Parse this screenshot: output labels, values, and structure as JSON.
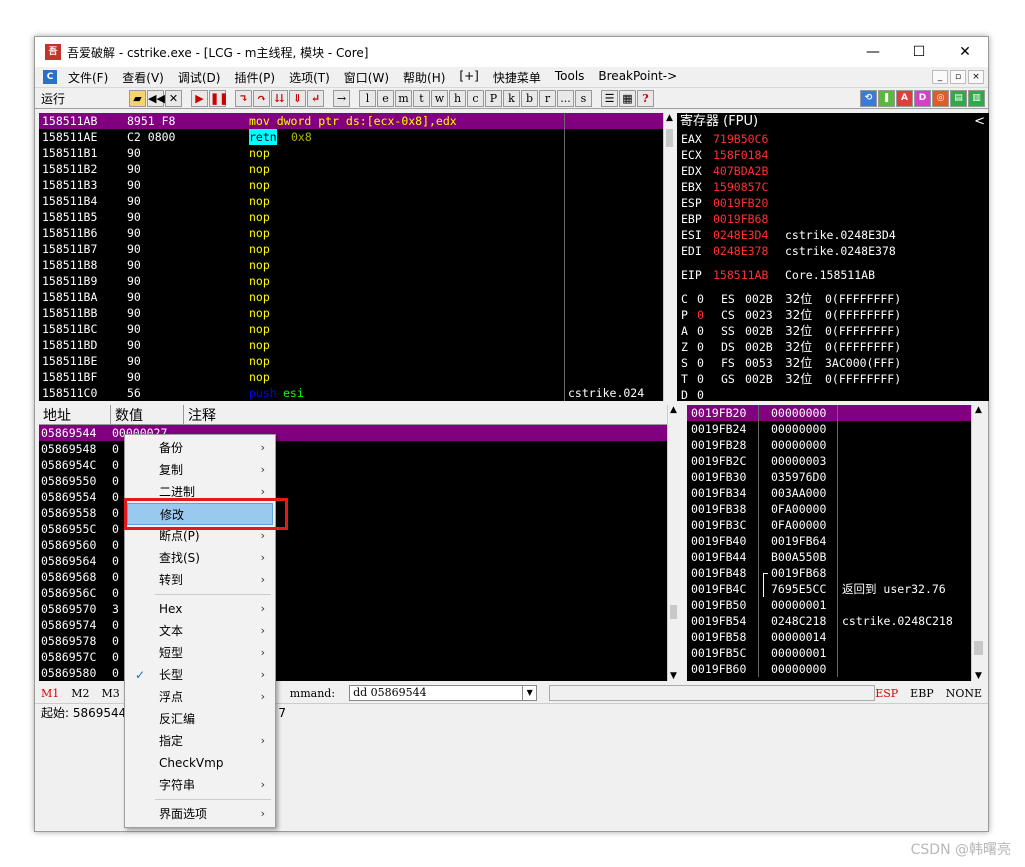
{
  "titlebar": {
    "title": "吾爱破解 - cstrike.exe - [LCG - m主线程, 模块 - Core]",
    "icon": "52pojie-logo",
    "min": "—",
    "max": "☐",
    "close": "✕"
  },
  "menu": [
    "文件(F)",
    "查看(V)",
    "调试(D)",
    "插件(P)",
    "选项(T)",
    "窗口(W)",
    "帮助(H)",
    "[+]",
    "快捷菜单",
    "Tools",
    "BreakPoint->"
  ],
  "mdi": [
    "_",
    "▫",
    "×"
  ],
  "toolbar": {
    "status": "运行",
    "letters": [
      "l",
      "e",
      "m",
      "t",
      "w",
      "h",
      "c",
      "P",
      "k",
      "b",
      "r",
      "...",
      "s"
    ]
  },
  "disasm": {
    "rows": [
      {
        "addr": "158511AB",
        "hex": "8951 F8",
        "asm": "mov dword ptr ds:[ecx-0x8],edx",
        "cmt": "",
        "sel": true
      },
      {
        "addr": "158511AE",
        "hex": "C2 0800",
        "asm": "retn",
        "op": "0x8",
        "cmt": ""
      },
      {
        "addr": "158511B1",
        "hex": "90",
        "asm": "nop",
        "cmt": ""
      },
      {
        "addr": "158511B2",
        "hex": "90",
        "asm": "nop",
        "cmt": ""
      },
      {
        "addr": "158511B3",
        "hex": "90",
        "asm": "nop",
        "cmt": ""
      },
      {
        "addr": "158511B4",
        "hex": "90",
        "asm": "nop",
        "cmt": ""
      },
      {
        "addr": "158511B5",
        "hex": "90",
        "asm": "nop",
        "cmt": ""
      },
      {
        "addr": "158511B6",
        "hex": "90",
        "asm": "nop",
        "cmt": ""
      },
      {
        "addr": "158511B7",
        "hex": "90",
        "asm": "nop",
        "cmt": ""
      },
      {
        "addr": "158511B8",
        "hex": "90",
        "asm": "nop",
        "cmt": ""
      },
      {
        "addr": "158511B9",
        "hex": "90",
        "asm": "nop",
        "cmt": ""
      },
      {
        "addr": "158511BA",
        "hex": "90",
        "asm": "nop",
        "cmt": ""
      },
      {
        "addr": "158511BB",
        "hex": "90",
        "asm": "nop",
        "cmt": ""
      },
      {
        "addr": "158511BC",
        "hex": "90",
        "asm": "nop",
        "cmt": ""
      },
      {
        "addr": "158511BD",
        "hex": "90",
        "asm": "nop",
        "cmt": ""
      },
      {
        "addr": "158511BE",
        "hex": "90",
        "asm": "nop",
        "cmt": ""
      },
      {
        "addr": "158511BF",
        "hex": "90",
        "asm": "nop",
        "cmt": ""
      },
      {
        "addr": "158511C0",
        "hex": "56",
        "asm": "push",
        "op": "esi",
        "cmt": "cstrike.024"
      }
    ]
  },
  "registers": {
    "title": "寄存器 (FPU)",
    "regs": [
      {
        "n": "EAX",
        "v": "719B50C6",
        "c": ""
      },
      {
        "n": "ECX",
        "v": "158F0184",
        "c": ""
      },
      {
        "n": "EDX",
        "v": "407BDA2B",
        "c": ""
      },
      {
        "n": "EBX",
        "v": "1590857C",
        "c": ""
      },
      {
        "n": "ESP",
        "v": "0019FB20",
        "c": ""
      },
      {
        "n": "EBP",
        "v": "0019FB68",
        "c": ""
      },
      {
        "n": "ESI",
        "v": "0248E3D4",
        "c": "cstrike.0248E3D4"
      },
      {
        "n": "EDI",
        "v": "0248E378",
        "c": "cstrike.0248E378"
      }
    ],
    "eip": {
      "n": "EIP",
      "v": "158511AB",
      "c": "Core.158511AB"
    },
    "flags": [
      {
        "f": "C",
        "b": "0",
        "seg": "ES",
        "sel": "002B",
        "bits": "32位",
        "base": "0(FFFFFFFF)"
      },
      {
        "f": "P",
        "b": "0",
        "seg": "CS",
        "sel": "0023",
        "bits": "32位",
        "base": "0(FFFFFFFF)",
        "red": true
      },
      {
        "f": "A",
        "b": "0",
        "seg": "SS",
        "sel": "002B",
        "bits": "32位",
        "base": "0(FFFFFFFF)"
      },
      {
        "f": "Z",
        "b": "0",
        "seg": "DS",
        "sel": "002B",
        "bits": "32位",
        "base": "0(FFFFFFFF)"
      },
      {
        "f": "S",
        "b": "0",
        "seg": "FS",
        "sel": "0053",
        "bits": "32位",
        "base": "3AC000(FFF)"
      },
      {
        "f": "T",
        "b": "0",
        "seg": "GS",
        "sel": "002B",
        "bits": "32位",
        "base": "0(FFFFFFFF)"
      }
    ],
    "lastflag": {
      "f": "D",
      "b": "0"
    }
  },
  "dump": {
    "headers": [
      "地址",
      "数值",
      "注释"
    ],
    "first_value": "00000027",
    "rows": [
      {
        "addr": "05869544",
        "val": "0"
      },
      {
        "addr": "05869548",
        "val": "0"
      },
      {
        "addr": "0586954C",
        "val": "0"
      },
      {
        "addr": "05869550",
        "val": "0"
      },
      {
        "addr": "05869554",
        "val": "0"
      },
      {
        "addr": "05869558",
        "val": "0"
      },
      {
        "addr": "0586955C",
        "val": "0"
      },
      {
        "addr": "05869560",
        "val": "0"
      },
      {
        "addr": "05869564",
        "val": "0"
      },
      {
        "addr": "05869568",
        "val": "0"
      },
      {
        "addr": "0586956C",
        "val": "0"
      },
      {
        "addr": "05869570",
        "val": "3"
      },
      {
        "addr": "05869574",
        "val": "0"
      },
      {
        "addr": "05869578",
        "val": "0"
      },
      {
        "addr": "0586957C",
        "val": "0"
      },
      {
        "addr": "05869580",
        "val": "0"
      }
    ]
  },
  "stack": {
    "rows": [
      {
        "addr": "0019FB20",
        "val": "00000000",
        "c": "",
        "sel": true
      },
      {
        "addr": "0019FB24",
        "val": "00000000",
        "c": ""
      },
      {
        "addr": "0019FB28",
        "val": "00000000",
        "c": ""
      },
      {
        "addr": "0019FB2C",
        "val": "00000003",
        "c": ""
      },
      {
        "addr": "0019FB30",
        "val": "035976D0",
        "c": ""
      },
      {
        "addr": "0019FB34",
        "val": "003AA000",
        "c": ""
      },
      {
        "addr": "0019FB38",
        "val": "0FA00000",
        "c": ""
      },
      {
        "addr": "0019FB3C",
        "val": "0FA00000",
        "c": ""
      },
      {
        "addr": "0019FB40",
        "val": "0019FB64",
        "c": ""
      },
      {
        "addr": "0019FB44",
        "val": "B00A550B",
        "c": ""
      },
      {
        "addr": "0019FB48",
        "val": "0019FB68",
        "c": "",
        "bracket": true
      },
      {
        "addr": "0019FB4C",
        "val": "7695E5CC",
        "c": "返回到 user32.76"
      },
      {
        "addr": "0019FB50",
        "val": "00000001",
        "c": ""
      },
      {
        "addr": "0019FB54",
        "val": "0248C218",
        "c": "cstrike.0248C218"
      },
      {
        "addr": "0019FB58",
        "val": "00000014",
        "c": ""
      },
      {
        "addr": "0019FB5C",
        "val": "00000001",
        "c": ""
      },
      {
        "addr": "0019FB60",
        "val": "00000000",
        "c": ""
      }
    ]
  },
  "cmdbar": {
    "tabs": [
      "M1",
      "M2",
      "M3"
    ],
    "label": "mmand:",
    "command": "dd 05869544",
    "regs": [
      "ESP",
      "EBP",
      "NONE"
    ]
  },
  "statusbar": {
    "left": "起始: 5869544",
    "right": "7"
  },
  "contextmenu": [
    {
      "label": "备份",
      "sub": true
    },
    {
      "label": "复制",
      "sub": true
    },
    {
      "label": "二进制",
      "sub": true
    },
    {
      "label": "修改",
      "sub": false,
      "hl": true
    },
    {
      "label": "断点(P)",
      "sub": true
    },
    {
      "label": "查找(S)",
      "sub": true
    },
    {
      "label": "转到",
      "sub": true
    },
    {
      "sep": true
    },
    {
      "label": "Hex",
      "sub": true
    },
    {
      "label": "文本",
      "sub": true
    },
    {
      "label": "短型",
      "sub": true
    },
    {
      "label": "长型",
      "sub": true,
      "check": true
    },
    {
      "label": "浮点",
      "sub": true
    },
    {
      "label": "反汇编",
      "sub": false
    },
    {
      "label": "指定",
      "sub": true
    },
    {
      "label": "CheckVmp",
      "sub": false
    },
    {
      "label": "字符串",
      "sub": true
    },
    {
      "sep": true
    },
    {
      "label": "界面选项",
      "sub": true
    }
  ],
  "watermark": "CSDN @韩曙亮"
}
